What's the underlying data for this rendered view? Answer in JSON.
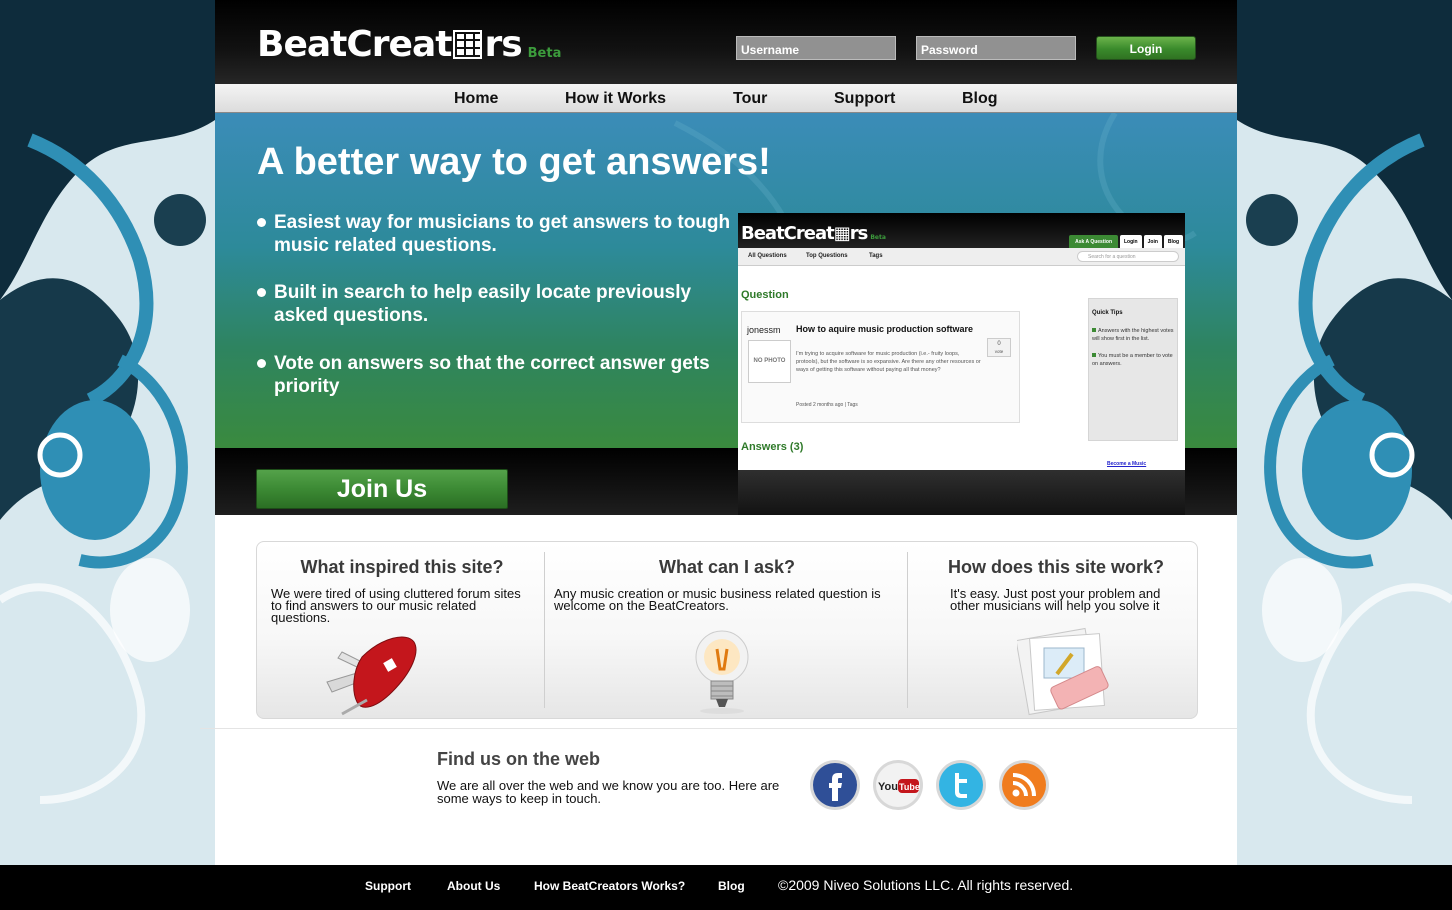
{
  "brand": {
    "name_part1": "BeatCreat",
    "name_part2": "rs",
    "beta": "Beta"
  },
  "login": {
    "username_placeholder": "Username",
    "password_placeholder": "Password",
    "button": "Login"
  },
  "nav": {
    "items": [
      "Home",
      "How it Works",
      "Tour",
      "Support",
      "Blog"
    ]
  },
  "hero": {
    "title": "A better way to get answers!",
    "bullets": [
      "Easiest way for musicians to get answers to tough music related questions.",
      "Built in search to help easily locate previously asked questions.",
      "Vote on answers so that the correct answer gets priority"
    ],
    "join_button": "Join Us"
  },
  "preview": {
    "logo": "BeatCreat▦rs",
    "beta": "Beta",
    "tabs": [
      "Ask A Question",
      "Login",
      "Join",
      "Blog"
    ],
    "nav": [
      "All Questions",
      "Top Questions",
      "Tags"
    ],
    "search_placeholder": "Search for a question",
    "question_heading": "Question",
    "user": "jonessm",
    "photo_label": "NO PHOTO",
    "question_title": "How to aquire music production software",
    "question_body": "I'm trying to acquire software for music production (i.e.- fruity loops, protools), but the software is so expansive. Are there any other resources or ways of getting this software without paying all that money?",
    "posted": "Posted 2 months ago | Tags",
    "votes": "0",
    "votes_label": "vote",
    "tips_title": "Quick Tips",
    "tips": [
      "Answers with the highest votes will show first in the list.",
      "You must be a member to vote on answers."
    ],
    "answers_heading": "Answers (3)",
    "side_link": "Become a Music"
  },
  "info": {
    "columns": [
      {
        "title": "What inspired this site?",
        "text": "We were tired of using cluttered forum sites to  find answers to our music related questions."
      },
      {
        "title": "What can I ask?",
        "text": "Any music creation or music business related question is welcome on the BeatCreators."
      },
      {
        "title": "How does this site work?",
        "text": "It's easy. Just post your problem and other musicians will help you solve it"
      }
    ]
  },
  "find": {
    "title": "Find us on the web",
    "text": "We are all over the web and we know you are too. Here are some ways to keep in touch.",
    "icons": [
      "facebook-icon",
      "youtube-icon",
      "twitter-icon",
      "rss-icon"
    ]
  },
  "footer": {
    "links": [
      "Support",
      "About Us",
      "How BeatCreators Works?",
      "Blog"
    ],
    "copyright": "©2009 Niveo Solutions LLC. All rights reserved."
  },
  "colors": {
    "accent_green": "#3c8a34",
    "hero_blue": "#3b8cb8",
    "side_blue": "#2f8fb5"
  }
}
